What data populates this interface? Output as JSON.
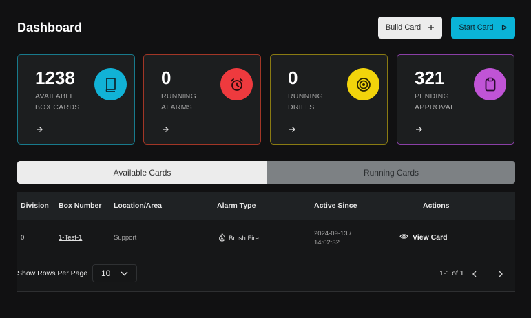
{
  "header": {
    "title": "Dashboard",
    "build_card_label": "Build Card",
    "start_card_label": "Start Card"
  },
  "stats": [
    {
      "count": "1238",
      "label_line1": "AVAILABLE",
      "label_line2": "BOX CARDS",
      "icon": "book-icon",
      "color": "#11b2d6"
    },
    {
      "count": "0",
      "label_line1": "RUNNING",
      "label_line2": "ALARMS",
      "icon": "alarm-clock-icon",
      "color": "#ee3a3e"
    },
    {
      "count": "0",
      "label_line1": "RUNNING",
      "label_line2": "DRILLS",
      "icon": "target-icon",
      "color": "#f2d40b"
    },
    {
      "count": "321",
      "label_line1": "PENDING",
      "label_line2": "APPROVAL",
      "icon": "clipboard-icon",
      "color": "#c054d6"
    }
  ],
  "tabs": [
    {
      "label": "Available Cards",
      "active": true
    },
    {
      "label": "Running Cards",
      "active": false
    }
  ],
  "table": {
    "columns": [
      "Division",
      "Box Number",
      "Location/Area",
      "Alarm Type",
      "Active Since",
      "Actions"
    ],
    "rows": [
      {
        "division": "0",
        "box_number": "1-Test-1",
        "location": "Support",
        "alarm_type": "Brush Fire",
        "active_since_date": "2024-09-13 /",
        "active_since_time": "14:02:32",
        "action": "View Card"
      }
    ]
  },
  "pagination": {
    "rows_label": "Show Rows Per Page",
    "rows_per_page": "10",
    "page_info": "1-1 of 1"
  }
}
